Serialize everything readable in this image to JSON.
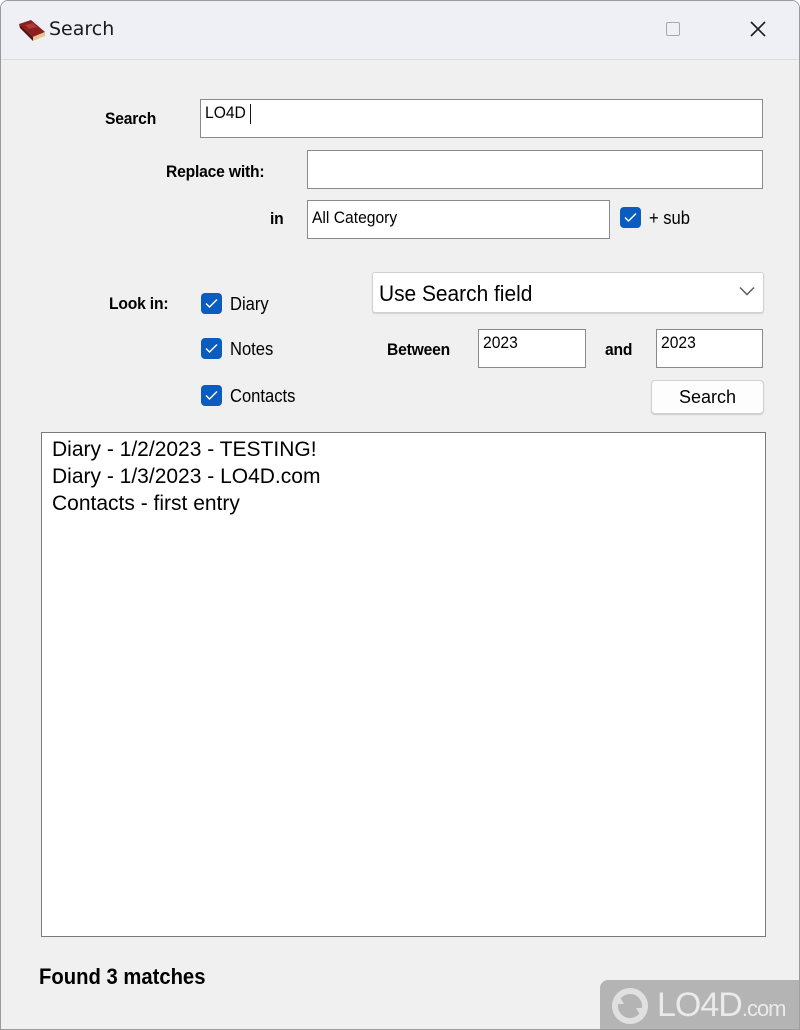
{
  "window": {
    "title": "Search",
    "app_icon": "book-icon",
    "controls": [
      "maximize-icon",
      "close-icon"
    ]
  },
  "form": {
    "search_label": "Search",
    "search_value": "LO4D",
    "replace_label": "Replace with:",
    "replace_value": "",
    "in_label": "in",
    "category_value": "All Category",
    "sub_checked": true,
    "sub_label": "+ sub",
    "look_in_label": "Look in:",
    "look_in": [
      {
        "label": "Diary",
        "checked": true
      },
      {
        "label": "Notes",
        "checked": true
      },
      {
        "label": "Contacts",
        "checked": true
      }
    ],
    "mode_select_value": "Use Search field",
    "between_label": "Between",
    "between_from": "2023",
    "and_label": "and",
    "between_to": "2023",
    "search_button": "Search"
  },
  "results": [
    "Diary - 1/2/2023 - TESTING!",
    "Diary - 1/3/2023 - LO4D.com",
    "Contacts - first entry"
  ],
  "status": "Found 3 matches",
  "watermark": {
    "main": "LO4D",
    "suffix": ".com"
  }
}
